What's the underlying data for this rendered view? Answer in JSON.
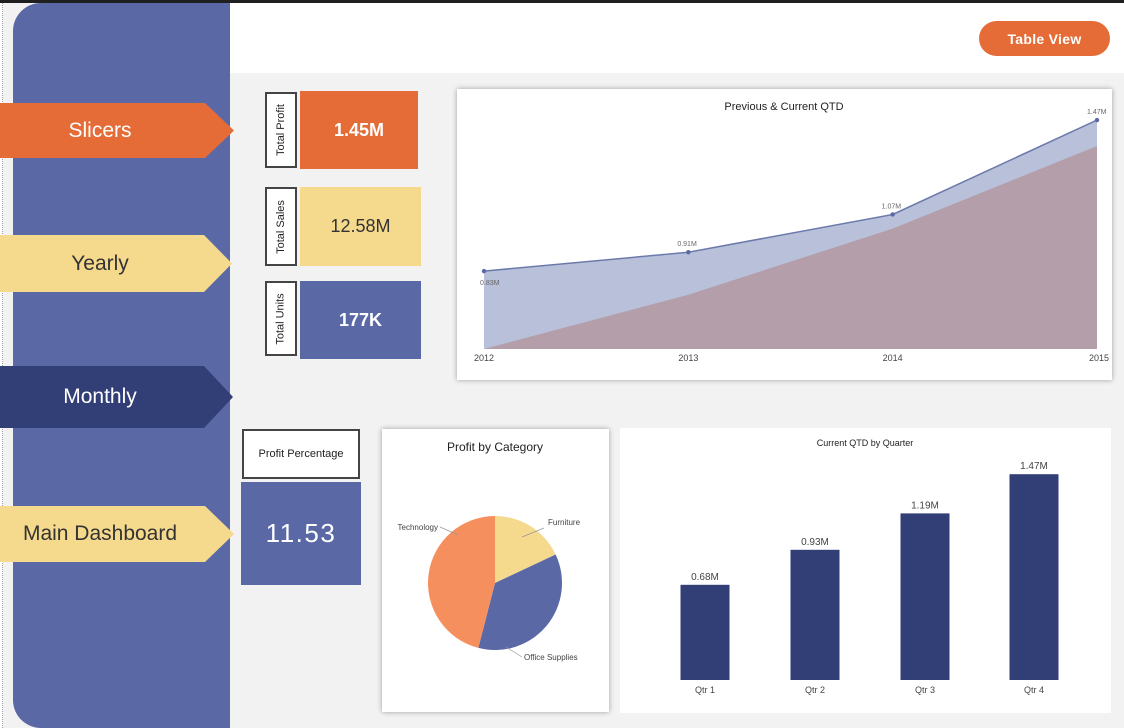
{
  "header": {
    "table_view_label": "Table View"
  },
  "nav": {
    "slicers": "Slicers",
    "yearly": "Yearly",
    "monthly": "Monthly",
    "main_dashboard": "Main Dashboard"
  },
  "kpis": {
    "profit": {
      "label": "Total Profit",
      "value": "1.45M"
    },
    "sales": {
      "label": "Total Sales",
      "value": "12.58M"
    },
    "units": {
      "label": "Total Units",
      "value": "177K"
    }
  },
  "profit_percentage": {
    "label": "Profit Percentage",
    "value": "11.53"
  },
  "colors": {
    "orange": "#e56c37",
    "yellow": "#f5d98c",
    "blue": "#5a69a6",
    "navy": "#323f76"
  },
  "chart_data": [
    {
      "type": "area",
      "title": "Previous & Current QTD",
      "categories": [
        "2012",
        "2013",
        "2014",
        "2015"
      ],
      "series": [
        {
          "values": [
            0.83,
            0.91,
            1.07,
            1.47
          ],
          "labels": [
            "0.83M",
            "0.91M",
            "1.07M",
            "1.47M"
          ]
        },
        {
          "values": [
            0.5,
            0.73,
            1.01,
            1.36
          ]
        }
      ],
      "ylim": [
        0.5,
        1.5
      ]
    },
    {
      "type": "pie",
      "title": "Profit by Category",
      "categories": [
        "Furniture",
        "Office Supplies",
        "Technology"
      ],
      "values": [
        18,
        36,
        46
      ],
      "colors": [
        "#f5d98c",
        "#5a69a6",
        "#f5905e"
      ]
    },
    {
      "type": "bar",
      "title": "Current QTD by Quarter",
      "categories": [
        "Qtr 1",
        "Qtr 2",
        "Qtr 3",
        "Qtr 4"
      ],
      "values": [
        0.68,
        0.93,
        1.19,
        1.47
      ],
      "labels": [
        "0.68M",
        "0.93M",
        "1.19M",
        "1.47M"
      ],
      "ylim": [
        0,
        1.5
      ]
    }
  ]
}
